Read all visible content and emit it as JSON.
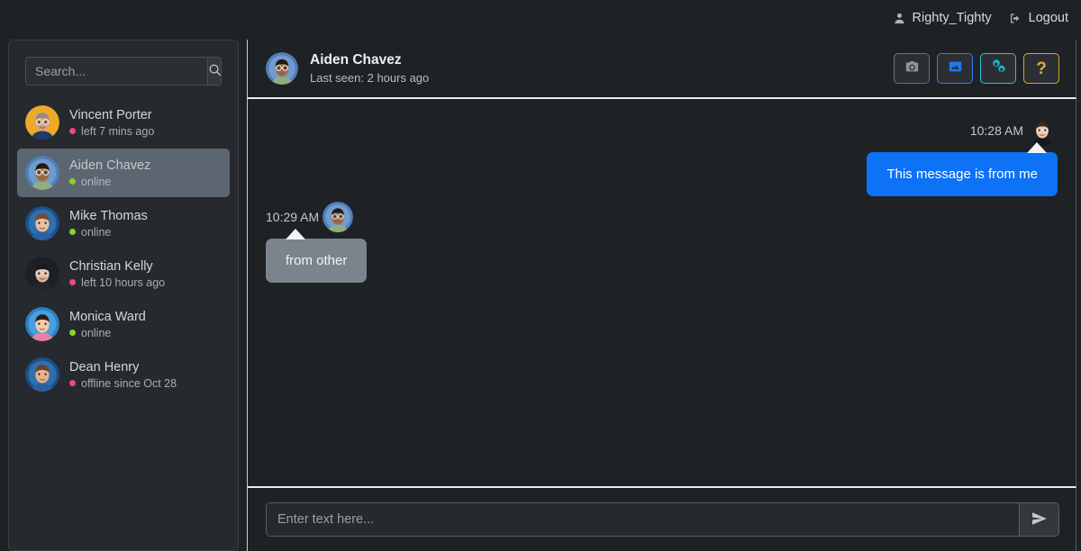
{
  "topbar": {
    "username": "Righty_Tighty",
    "logout_label": "Logout",
    "user_icon": "user-icon",
    "logout_icon": "sign-out-icon"
  },
  "sidebar": {
    "search": {
      "placeholder": "Search...",
      "value": "",
      "icon": "search-icon"
    },
    "contacts": [
      {
        "name": "Vincent Porter",
        "status": "left 7 mins ago",
        "state": "offline",
        "dot_color": "#e8488b",
        "avatar": "vincent"
      },
      {
        "name": "Aiden Chavez",
        "status": "online",
        "state": "online",
        "dot_color": "#8ad12a",
        "avatar": "aiden"
      },
      {
        "name": "Mike Thomas",
        "status": "online",
        "state": "online",
        "dot_color": "#8ad12a",
        "avatar": "mike"
      },
      {
        "name": "Christian Kelly",
        "status": "left 10 hours ago",
        "state": "offline",
        "dot_color": "#e8488b",
        "avatar": "christian"
      },
      {
        "name": "Monica Ward",
        "status": "online",
        "state": "online",
        "dot_color": "#8ad12a",
        "avatar": "monica"
      },
      {
        "name": "Dean Henry",
        "status": "offline since Oct 28",
        "state": "offline",
        "dot_color": "#e8488b",
        "avatar": "dean"
      }
    ],
    "selected_index": 1
  },
  "chat": {
    "peer_name": "Aiden Chavez",
    "last_seen": "Last seen: 2 hours ago",
    "actions": [
      {
        "name": "camera-button",
        "icon": "camera-icon",
        "color": "#8e959b"
      },
      {
        "name": "image-button",
        "icon": "image-icon",
        "color": "#1a7bf2"
      },
      {
        "name": "settings-button",
        "icon": "gears-icon",
        "color": "#18c0d4"
      },
      {
        "name": "help-button",
        "icon": "question-icon",
        "color": "#e0ad2e",
        "glyph": "?"
      }
    ],
    "messages": [
      {
        "direction": "out",
        "time": "10:28 AM",
        "text": "This message is from me",
        "avatar": "me"
      },
      {
        "direction": "in",
        "time": "10:29 AM",
        "text": "from other",
        "avatar": "aiden"
      }
    ],
    "composer": {
      "placeholder": "Enter text here...",
      "value": "",
      "send_icon": "send-icon"
    }
  },
  "colors": {
    "accent_blue": "#0d72f5",
    "bubble_gray": "#7b848d",
    "online": "#8ad12a",
    "offline": "#e8488b"
  }
}
